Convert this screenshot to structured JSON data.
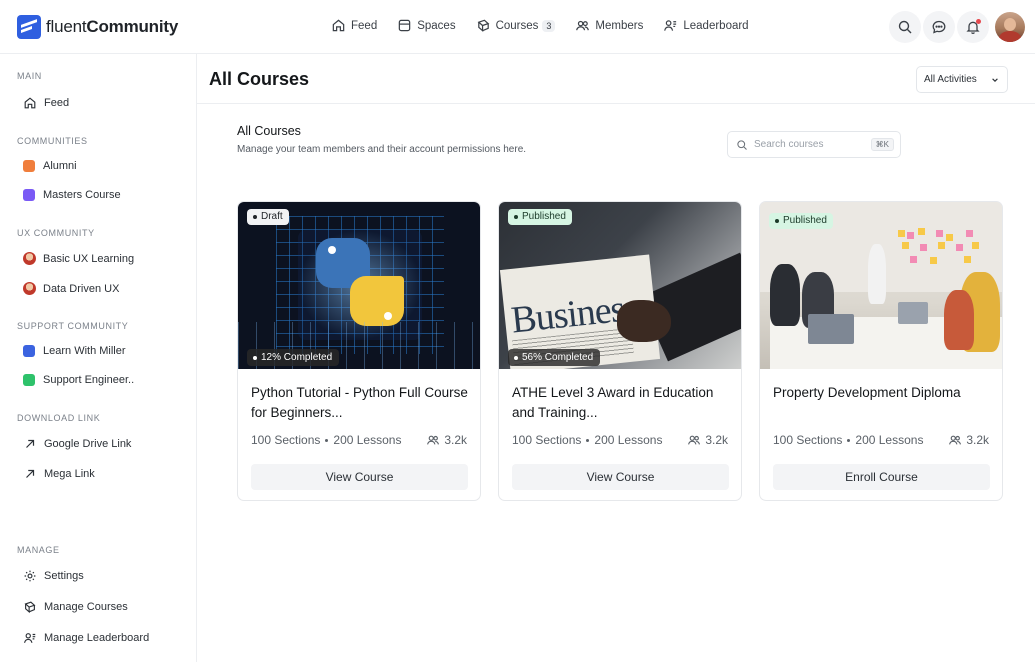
{
  "brand": {
    "light": "fluent",
    "bold": "Community"
  },
  "topnav": [
    {
      "label": "Feed",
      "icon": "home-icon"
    },
    {
      "label": "Spaces",
      "icon": "spaces-icon"
    },
    {
      "label": "Courses",
      "icon": "courses-icon",
      "badge": "3"
    },
    {
      "label": "Members",
      "icon": "members-icon"
    },
    {
      "label": "Leaderboard",
      "icon": "leaderboard-icon"
    }
  ],
  "sidebar": {
    "main_title": "MAIN",
    "feed": "Feed",
    "communities_title": "COMMUNITIES",
    "alumni": "Alumni",
    "masters": "Masters Course",
    "ux_title": "UX COMMUNITY",
    "basic_ux": "Basic UX Learning",
    "data_ux": "Data Driven UX",
    "support_title": "SUPPORT COMMUNITY",
    "learn_miller": "Learn With Miller",
    "support_eng": "Support Engineer..",
    "download_title": "DOWNLOAD LINK",
    "google_drive": "Google Drive Link",
    "mega": "Mega Link",
    "manage_title": "MANAGE",
    "settings": "Settings",
    "manage_courses": "Manage Courses",
    "manage_leaderboard": "Manage Leaderboard"
  },
  "colors": {
    "alumni": "#f07e3c",
    "masters": "#7a5af5",
    "miller": "#3b63e0",
    "support": "#2ec26b"
  },
  "main": {
    "page_title": "All Courses",
    "filter": "All Activities",
    "section_title": "All Courses",
    "section_desc": "Manage your team members and their account permissions here.",
    "search_placeholder": "Search courses",
    "search_shortcut": "⌘K"
  },
  "courses": [
    {
      "status": "Draft",
      "progress": "12% Completed",
      "title": "Python Tutorial - Python Full Course for Beginners...",
      "sections": "100 Sections",
      "lessons": "200 Lessons",
      "members": "3.2k",
      "button": "View Course"
    },
    {
      "status": "Published",
      "progress": "56% Completed",
      "title": "ATHE Level 3 Award in Education and Training...",
      "sections": "100 Sections",
      "lessons": "200 Lessons",
      "members": "3.2k",
      "button": "View Course",
      "image_text": "Business"
    },
    {
      "status": "Published",
      "title": "Property Development Diploma",
      "sections": "100 Sections",
      "lessons": "200 Lessons",
      "members": "3.2k",
      "button": "Enroll Course"
    }
  ]
}
